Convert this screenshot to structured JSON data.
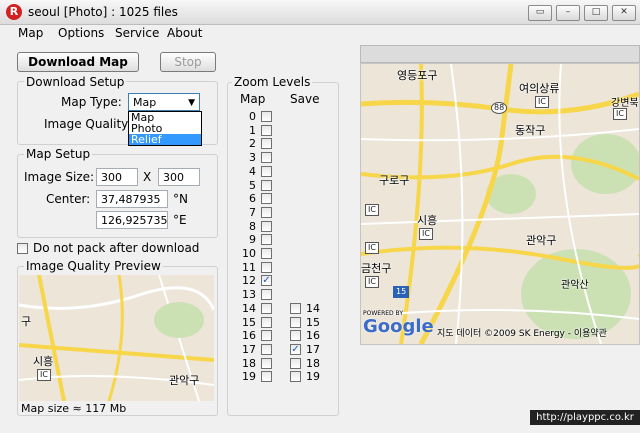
{
  "window": {
    "title": "seoul [Photo] : 1025 files",
    "controls": [
      "restore-icon",
      "minimize-icon",
      "maximize-icon",
      "close-icon"
    ]
  },
  "menu": {
    "items": [
      "Map",
      "Options",
      "Service",
      "About"
    ]
  },
  "toolbar": {
    "download_label": "Download Map",
    "stop_label": "Stop"
  },
  "download_setup": {
    "title": "Download Setup",
    "map_type_label": "Map Type:",
    "map_type_value": "Map",
    "image_quality_label": "Image Quality:",
    "dropdown_options": [
      "Map",
      "Photo",
      "Relief"
    ],
    "dropdown_highlighted": "Relief"
  },
  "map_setup": {
    "title": "Map Setup",
    "image_size_label": "Image Size:",
    "width": "300",
    "x_sep": "X",
    "height": "300",
    "center_label": "Center:",
    "lat": "37,487935",
    "lat_unit": "°N",
    "lon": "126,925735",
    "lon_unit": "°E"
  },
  "no_pack_label": "Do not pack after download",
  "preview": {
    "title": "Image Quality Preview",
    "map_size": "Map size ≈ 117 Mb"
  },
  "zoom": {
    "title": "Zoom Levels",
    "map_col": "Map",
    "save_col": "Save",
    "map_levels": [
      "0",
      "1",
      "2",
      "3",
      "4",
      "5",
      "6",
      "7",
      "8",
      "9",
      "10",
      "11",
      "12",
      "13",
      "14",
      "15",
      "16",
      "17",
      "18",
      "19"
    ],
    "map_checked": [
      "12"
    ],
    "save_levels": [
      "14",
      "15",
      "16",
      "17",
      "18",
      "19"
    ],
    "save_checked": [
      "17"
    ]
  },
  "map_large": {
    "labels": [
      "영등포구",
      "여의상류",
      "IC",
      "88",
      "동작구",
      "구로구",
      "IC",
      "시흥",
      "IC",
      "관악구",
      "IC",
      "금천구",
      "IC",
      "15",
      "관악산",
      "강변북",
      "IC"
    ],
    "powered": "POWERED BY",
    "google": "Google",
    "copyright": "지도 데이터 ©2009 SK Energy - 이용약관"
  },
  "map_small": {
    "labels": [
      "구",
      "시흥",
      "IC",
      "관악구"
    ]
  },
  "watermark": "http://playppc.co.kr",
  "colors": {
    "map_bg": "#ece5d8",
    "major_road": "#f7d64a",
    "park": "#cbe1b4",
    "dropdown_highlight": "#3399ff"
  }
}
